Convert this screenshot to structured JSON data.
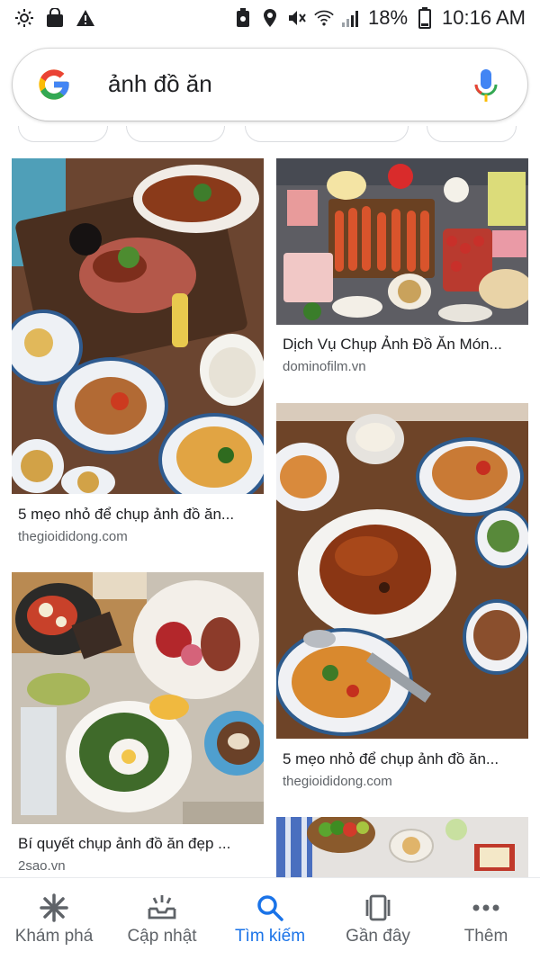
{
  "status_bar": {
    "battery_percent": "18%",
    "time": "10:16 AM",
    "icons_left": [
      "brightness-icon",
      "bag-icon",
      "warning-icon"
    ],
    "icons_right": [
      "nfc-icon",
      "location-icon",
      "mute-icon",
      "wifi-icon",
      "signal-icon",
      "battery-icon"
    ]
  },
  "search": {
    "query": "ảnh đồ ăn",
    "logo": "google-g-logo",
    "mic_icon": "mic-icon"
  },
  "results": [
    {
      "title": "5 mẹo nhỏ để chụp ảnh đồ ăn...",
      "source": "thegioididong.com",
      "image": "food-platter-photo"
    },
    {
      "title": "Dịch Vụ Chụp Ảnh Đồ Ăn Món...",
      "source": "dominofilm.vn",
      "image": "sausage-platter-photo"
    },
    {
      "title": "5 mẹo nhỏ để chụp ảnh đồ ăn...",
      "source": "thegioididong.com",
      "image": "roast-duck-photo"
    },
    {
      "title": "Bí quyết chụp ảnh đồ ăn đẹp ...",
      "source": "2sao.vn",
      "image": "brunch-table-photo"
    },
    {
      "title": "",
      "source": "",
      "image": "picnic-photo"
    }
  ],
  "bottom_nav": [
    {
      "label": "Khám phá",
      "icon": "asterisk-icon",
      "active": false
    },
    {
      "label": "Cập nhật",
      "icon": "tray-icon",
      "active": false
    },
    {
      "label": "Tìm kiếm",
      "icon": "search-icon",
      "active": true
    },
    {
      "label": "Gần đây",
      "icon": "cards-icon",
      "active": false
    },
    {
      "label": "Thêm",
      "icon": "more-icon",
      "active": false
    }
  ],
  "colors": {
    "accent": "#1a73e8",
    "text": "#202124",
    "secondary_text": "#5f6368",
    "google_blue": "#4285F4",
    "google_red": "#EA4335",
    "google_yellow": "#FBBC05",
    "google_green": "#34A853"
  }
}
